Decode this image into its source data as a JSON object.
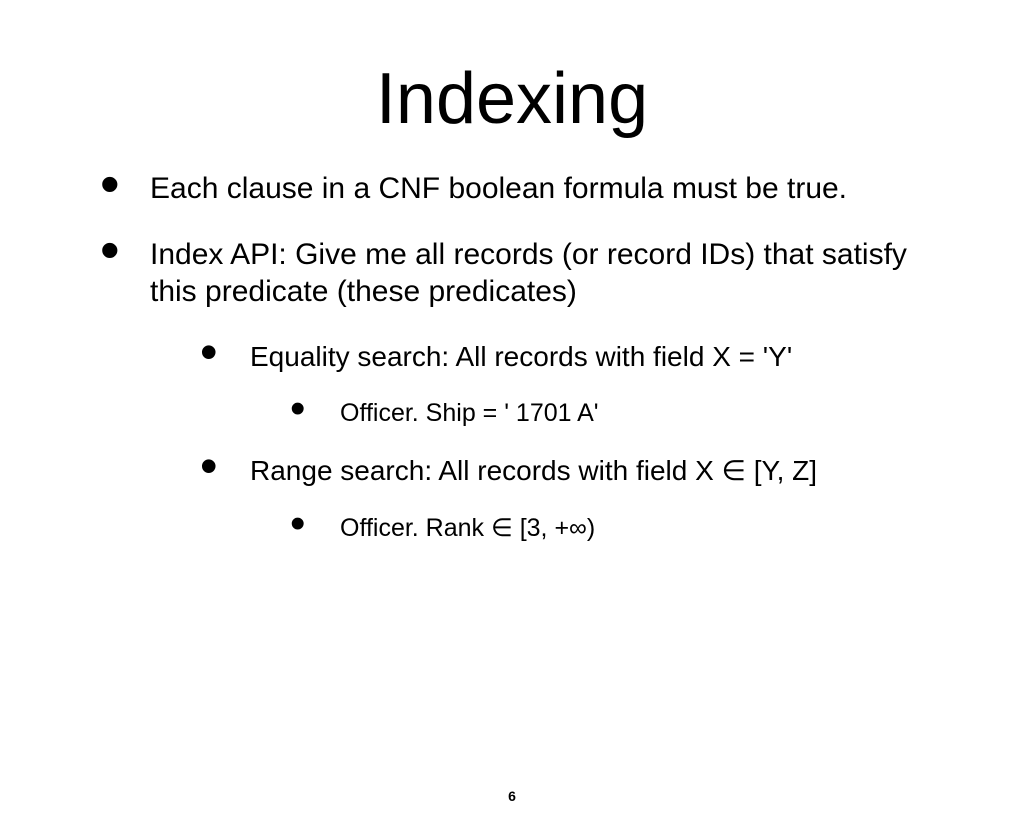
{
  "slide": {
    "title": "Indexing",
    "bullets": [
      {
        "text": "Each clause in a CNF boolean formula must be true."
      },
      {
        "text": "Index API: Give me all records (or record IDs) that satisfy this predicate (these predicates)",
        "children": [
          {
            "text": "Equality search: All records with field X = 'Y'",
            "children": [
              {
                "text": "Officer. Ship = ' 1701 A'"
              }
            ]
          },
          {
            "text": "Range search: All records with field X ∈ [Y, Z]",
            "children": [
              {
                "text": "Officer. Rank ∈ [3, +∞)"
              }
            ]
          }
        ]
      }
    ],
    "page_number": "6"
  }
}
